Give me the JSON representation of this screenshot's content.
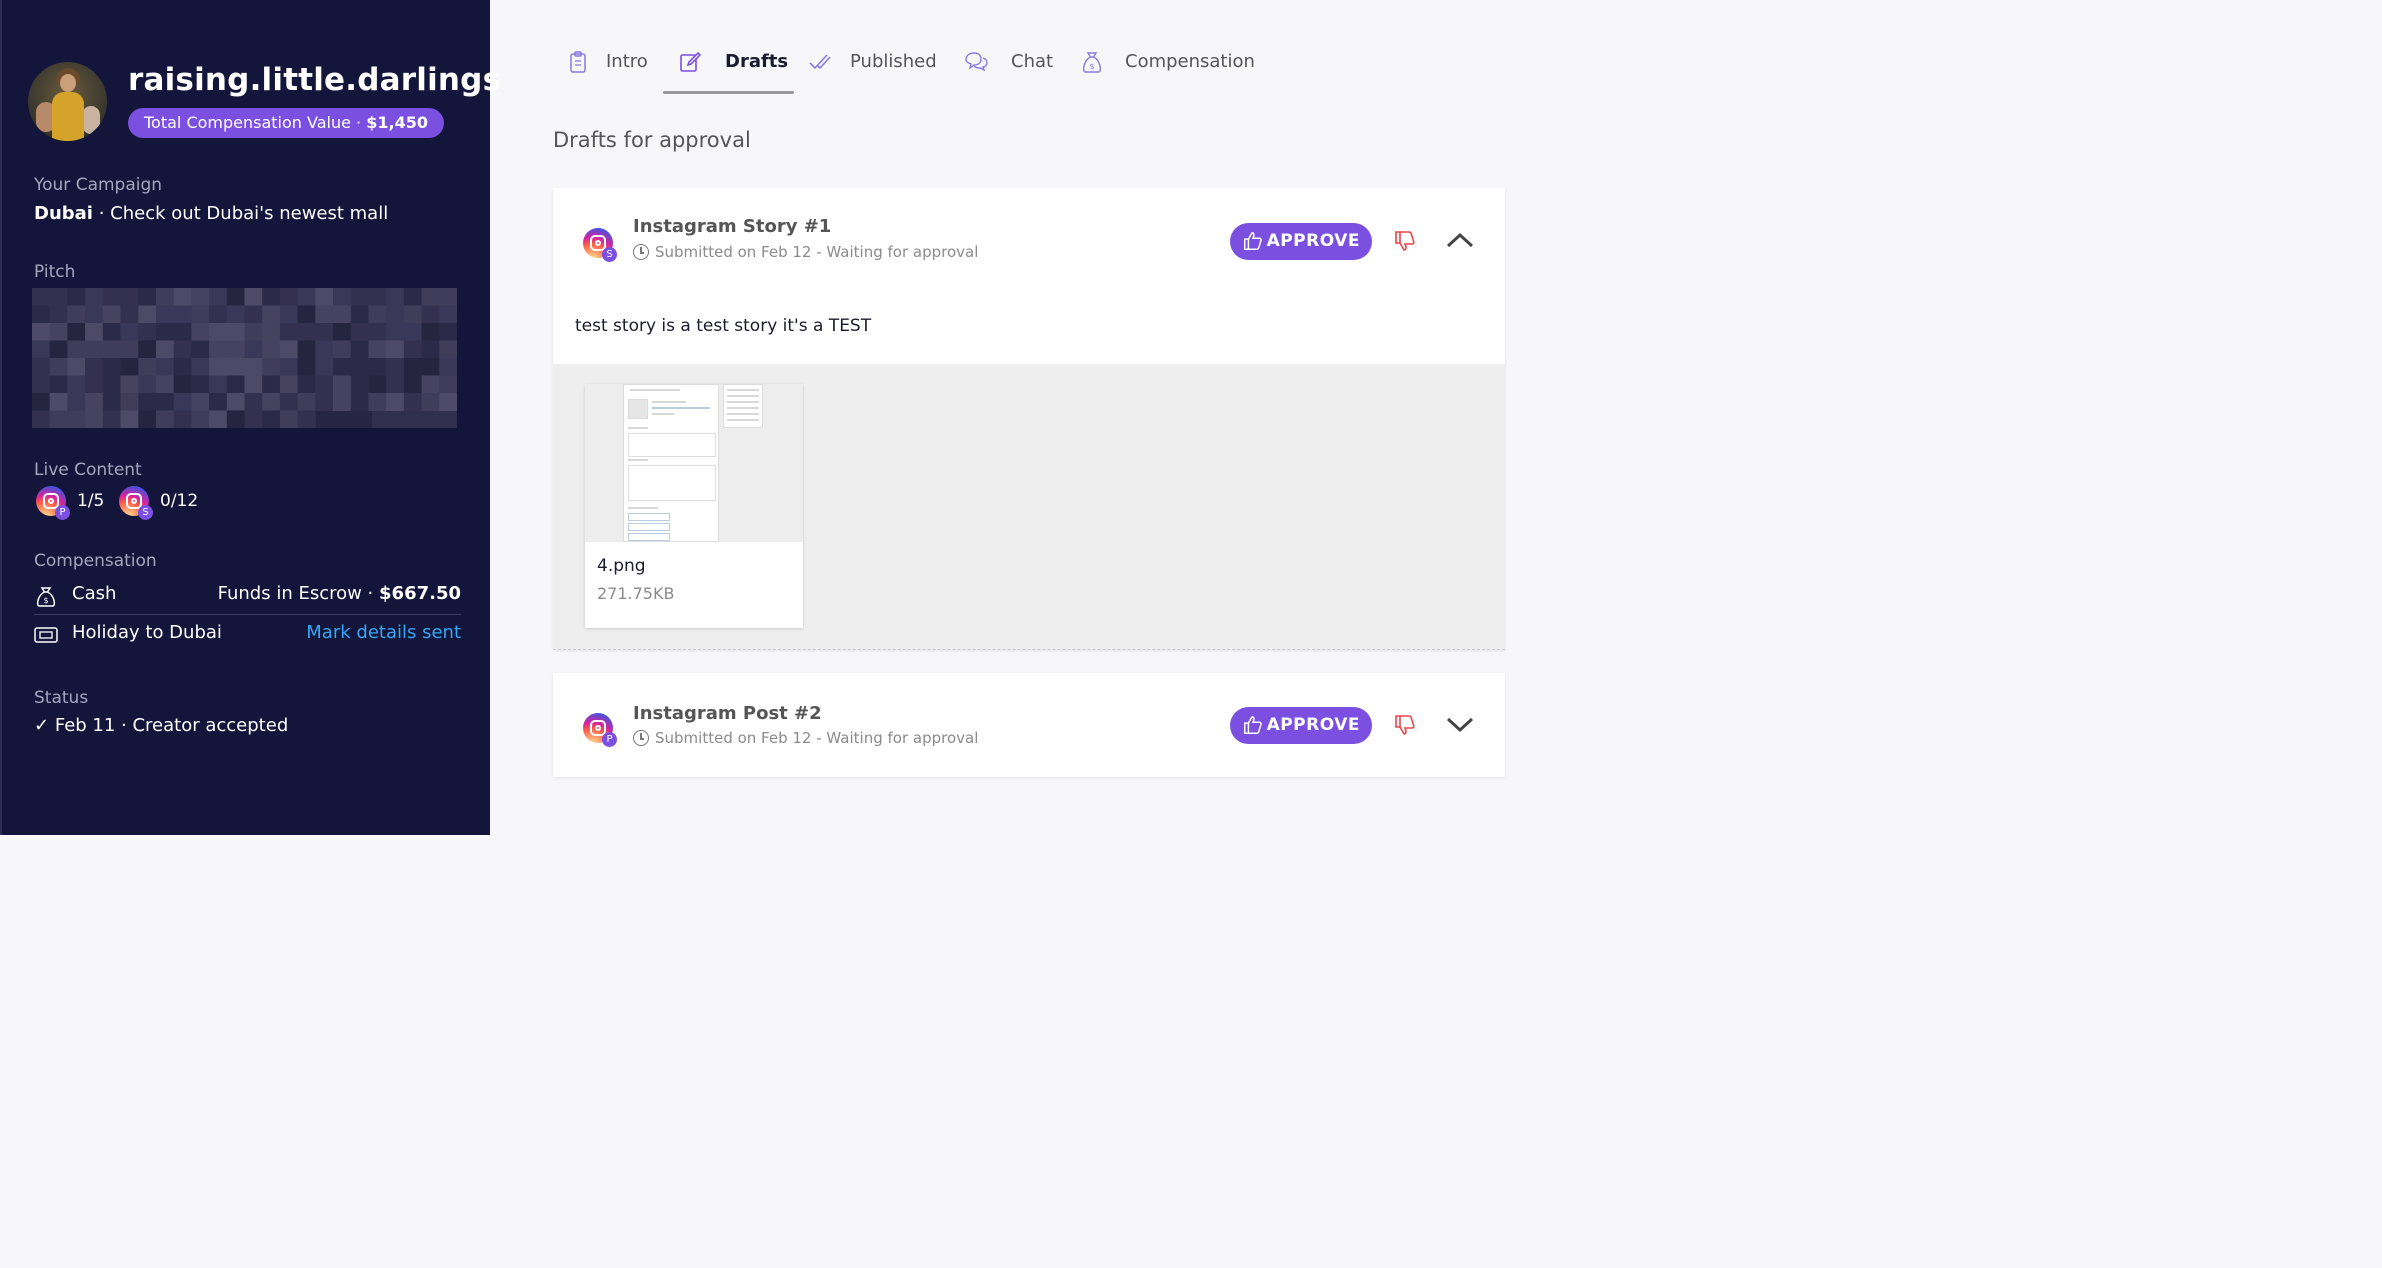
{
  "profile": {
    "handle": "raising.little.darlings",
    "tcv_label": "Total Compensation Value · ",
    "tcv_value": "$1,450"
  },
  "campaign": {
    "label": "Your Campaign",
    "name": "Dubai",
    "separator": " · ",
    "description": "Check out Dubai's newest mall"
  },
  "pitch": {
    "label": "Pitch"
  },
  "live_content": {
    "label": "Live Content",
    "items": [
      {
        "icon": "instagram-post-icon",
        "badge": "P",
        "count": "1/5"
      },
      {
        "icon": "instagram-story-icon",
        "badge": "S",
        "count": "0/12"
      }
    ]
  },
  "compensation": {
    "label": "Compensation",
    "items": [
      {
        "icon": "money-bag-icon",
        "label": "Cash",
        "right_prefix": "Funds in Escrow · ",
        "right_value": "$667.50"
      },
      {
        "icon": "ticket-icon",
        "label": "Holiday to Dubai",
        "action": "Mark details sent"
      }
    ]
  },
  "status": {
    "label": "Status",
    "text": "Feb 11 · Creator accepted"
  },
  "tabs": [
    {
      "label": "Intro",
      "icon": "clipboard-icon",
      "active": false
    },
    {
      "label": "Drafts",
      "icon": "edit-icon",
      "active": true
    },
    {
      "label": "Published",
      "icon": "double-check-icon",
      "active": false
    },
    {
      "label": "Chat",
      "icon": "chat-icon",
      "active": false
    },
    {
      "label": "Compensation",
      "icon": "money-bag-icon",
      "active": false
    }
  ],
  "page_heading": "Drafts for approval",
  "drafts": [
    {
      "title": "Instagram Story #1",
      "badge": "S",
      "status": "Submitted on Feb 12 - Waiting for approval",
      "approve_label": "APPROVE",
      "expanded": true,
      "description": "test story is a test story it's a TEST",
      "attachment": {
        "name": "4.png",
        "size": "271.75KB"
      }
    },
    {
      "title": "Instagram Post #2",
      "badge": "P",
      "status": "Submitted on Feb 12 - Waiting for approval",
      "approve_label": "APPROVE",
      "expanded": false
    }
  ],
  "colors": {
    "sidebar_bg": "#13163a",
    "accent": "#7b4fe0",
    "link": "#35a6f5",
    "reject": "#e8454a"
  }
}
